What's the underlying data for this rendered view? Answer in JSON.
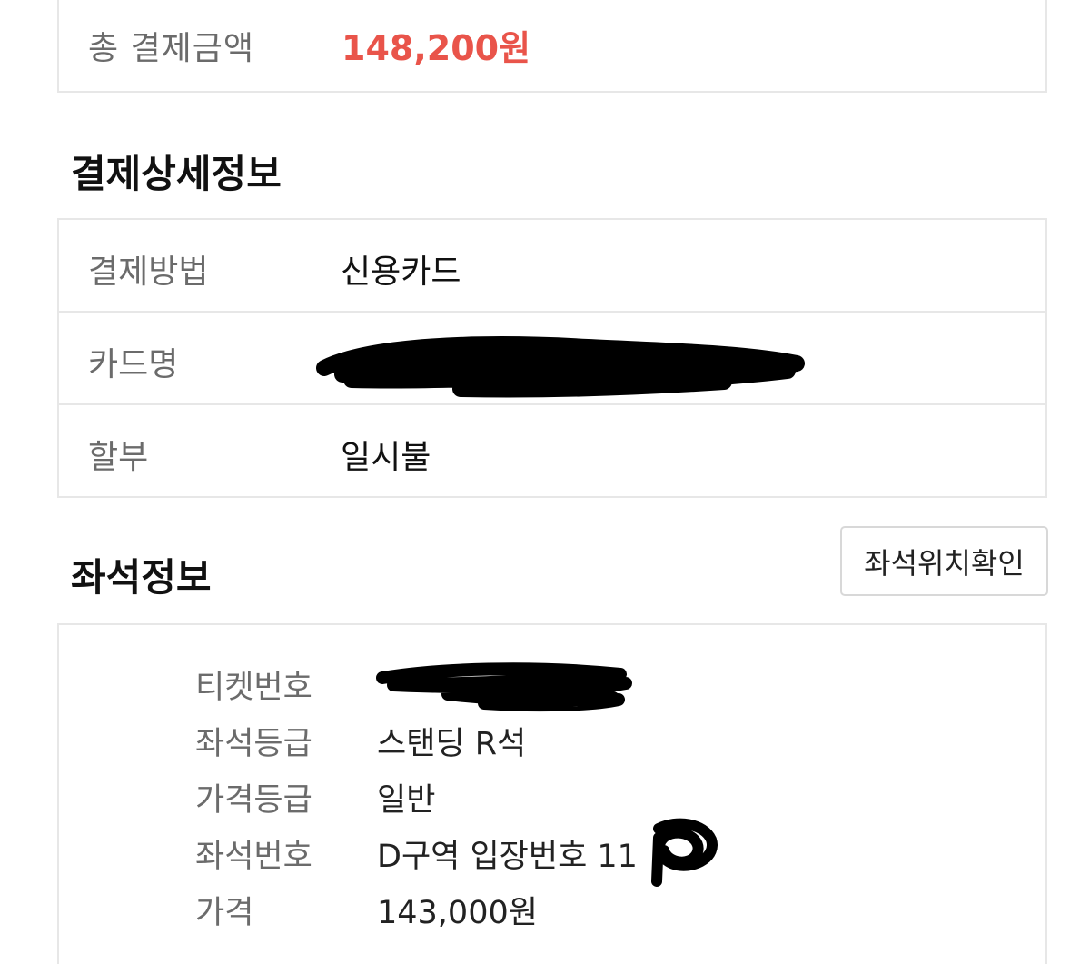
{
  "summary": {
    "total_label": "총 결제금액",
    "total_value": "148,200원",
    "accent_color": "#e9544a"
  },
  "payment": {
    "title": "결제상세정보",
    "rows": [
      {
        "label": "결제방법",
        "value": "신용카드"
      },
      {
        "label": "카드명",
        "value": ""
      },
      {
        "label": "할부",
        "value": "일시불"
      }
    ]
  },
  "seat": {
    "title": "좌석정보",
    "location_button": "좌석위치확인",
    "rows": [
      {
        "label": "티켓번호",
        "value": ""
      },
      {
        "label": "좌석등급",
        "value": "스탠딩 R석"
      },
      {
        "label": "가격등급",
        "value": "일반"
      },
      {
        "label": "좌석번호",
        "value": "D구역 입장번호 11"
      },
      {
        "label": "가격",
        "value": "143,000원"
      }
    ]
  }
}
